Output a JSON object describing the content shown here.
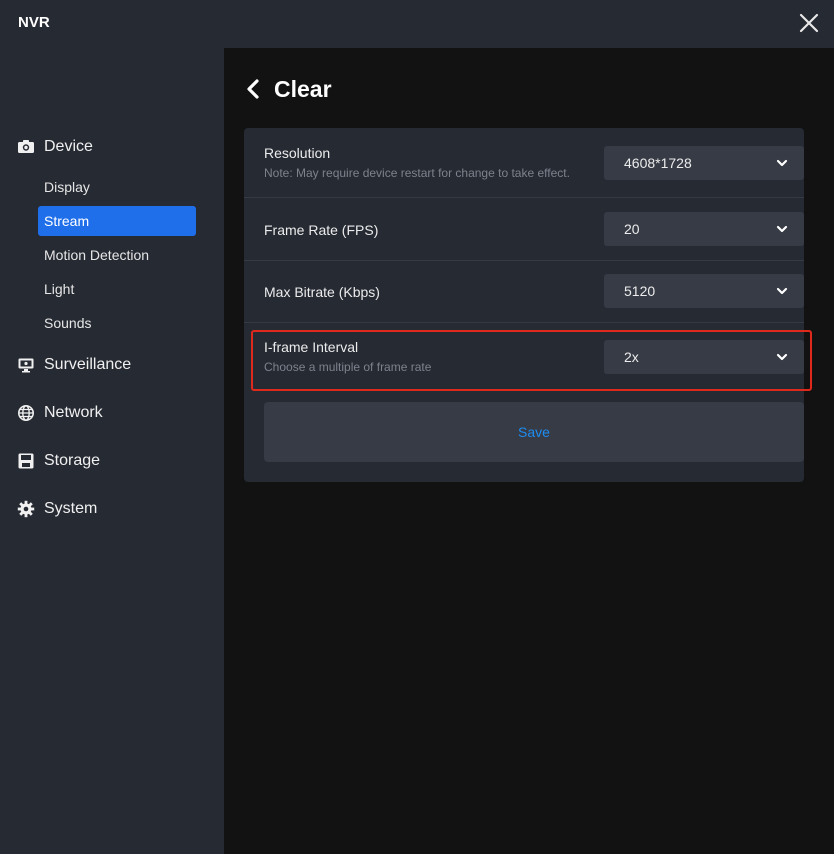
{
  "app": {
    "title": "NVR",
    "close_icon": "close-icon"
  },
  "sidebar": {
    "sections": [
      {
        "label": "Device",
        "icon": "camera-icon"
      },
      {
        "label": "Surveillance",
        "icon": "monitor-icon"
      },
      {
        "label": "Network",
        "icon": "globe-icon"
      },
      {
        "label": "Storage",
        "icon": "save-icon"
      },
      {
        "label": "System",
        "icon": "gear-icon"
      }
    ],
    "device_items": [
      {
        "label": "Display",
        "active": false
      },
      {
        "label": "Stream",
        "active": true
      },
      {
        "label": "Motion Detection",
        "active": false
      },
      {
        "label": "Light",
        "active": false
      },
      {
        "label": "Sounds",
        "active": false
      }
    ]
  },
  "main": {
    "title": "Clear",
    "back_icon": "chevron-left-icon",
    "settings": [
      {
        "label": "Resolution",
        "note": "Note: May require device restart for change to take effect.",
        "value": "4608*1728"
      },
      {
        "label": "Frame Rate (FPS)",
        "note": "",
        "value": "20"
      },
      {
        "label": "Max Bitrate (Kbps)",
        "note": "",
        "value": "5120"
      },
      {
        "label": "I-frame Interval",
        "note": "Choose a multiple of frame rate",
        "value": "2x"
      }
    ],
    "save_label": "Save"
  },
  "colors": {
    "accent": "#1f6feb",
    "link": "#1e8cf0",
    "highlight_border": "#e0291d",
    "panel_bg": "#262a33",
    "page_bg": "#121212"
  }
}
